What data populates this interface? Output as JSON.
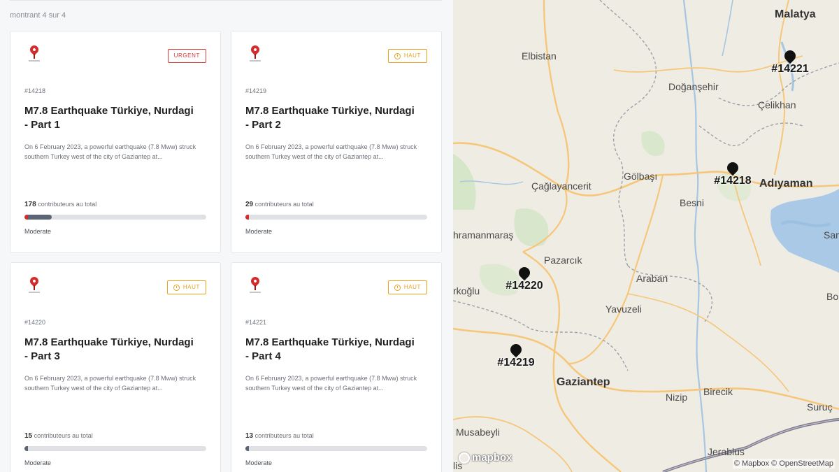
{
  "list": {
    "showing_text": "montrant 4 sur 4",
    "cards": [
      {
        "id": "#14218",
        "title": "M7.8 Earthquake Türkiye, Nurdagi - Part 1",
        "description": "On 6 February 2023, a powerful earthquake (7.8 Mww) struck southern Turkey west of the city of Gaziantep at...",
        "priority": "URGENT",
        "priority_kind": "urgent",
        "contributors_count": "178",
        "contributors_label": "contributeurs au total",
        "progress": 0.15,
        "difficulty": "Moderate"
      },
      {
        "id": "#14219",
        "title": "M7.8 Earthquake Türkiye, Nurdagi - Part 2",
        "description": "On 6 February 2023, a powerful earthquake (7.8 Mww) struck southern Turkey west of the city of Gaziantep at...",
        "priority": "HAUT",
        "priority_kind": "high",
        "contributors_count": "29",
        "contributors_label": "contributeurs au total",
        "progress": 0.01,
        "difficulty": "Moderate"
      },
      {
        "id": "#14220",
        "title": "M7.8 Earthquake Türkiye, Nurdagi - Part 3",
        "description": "On 6 February 2023, a powerful earthquake (7.8 Mww) struck southern Turkey west of the city of Gaziantep at...",
        "priority": "HAUT",
        "priority_kind": "high",
        "contributors_count": "15",
        "contributors_label": "contributeurs au total",
        "progress": 0.01,
        "difficulty": "Moderate"
      },
      {
        "id": "#14221",
        "title": "M7.8 Earthquake Türkiye, Nurdagi - Part 4",
        "description": "On 6 February 2023, a powerful earthquake (7.8 Mww) struck southern Turkey west of the city of Gaziantep at...",
        "priority": "HAUT",
        "priority_kind": "high",
        "contributors_count": "13",
        "contributors_label": "contributeurs au total",
        "progress": 0.02,
        "difficulty": "Moderate"
      }
    ]
  },
  "map": {
    "places": {
      "malatya": "Malatya",
      "elbistan": "Elbistan",
      "dogansehir": "Doğanşehir",
      "celikhan": "Çelikhan",
      "golbasi": "Gölbaşı",
      "caglayancerit": "Çağlayancerit",
      "adiyaman": "Adıyaman",
      "besni": "Besni",
      "kahramanmaras": "hramanmaraş",
      "pazarcik": "Pazarcık",
      "araban": "Araban",
      "turkoglu": "rkoğlu",
      "yavuzeli": "Yavuzeli",
      "gaziantep": "Gaziantep",
      "nizip": "Nizip",
      "birecik": "Birecik",
      "suruc": "Suruç",
      "musabeyli": "Musabeyli",
      "jerablus": "Jerablus",
      "sam": "Sam",
      "bo": "Bo",
      "kilis": "lis"
    },
    "markers": [
      "#14221",
      "#14218",
      "#14220",
      "#14219"
    ],
    "logo": "mapbox",
    "attribution": "© Mapbox © OpenStreetMap",
    "colors": {
      "land": "#efece4",
      "water": "#a9c9e6",
      "roads": "#f6c77a",
      "border": "#7a7f88"
    }
  }
}
